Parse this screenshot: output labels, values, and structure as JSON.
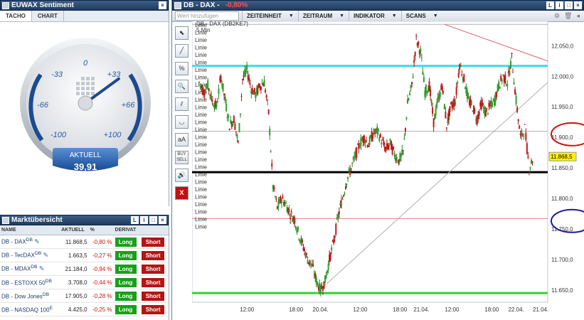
{
  "sentiment": {
    "title": "EUWAX Sentiment",
    "tabs": [
      "TACHO",
      "CHART"
    ],
    "scale_labels": [
      "0",
      "-33",
      "+33",
      "-66",
      "+66",
      "-100",
      "+100"
    ],
    "aktuell_label": "AKTUELL",
    "aktuell_value": "39,91",
    "gauge_value": 39.91
  },
  "market": {
    "title": "Marktübersicht",
    "columns": [
      "NAME",
      "AKTUELL",
      "%",
      "DERIVAT"
    ],
    "rows": [
      {
        "name": "DB - DAX",
        "sup": "DB",
        "edit": true,
        "value": "11.868,5",
        "pct": "-0,80 %"
      },
      {
        "name": "DB - TecDAX",
        "sup": "DB",
        "edit": true,
        "value": "1.663,5",
        "pct": "-0,27 %"
      },
      {
        "name": "DB - MDAX",
        "sup": "DB",
        "edit": true,
        "value": "21.184,0",
        "pct": "-0,94 %"
      },
      {
        "name": "DB - ESTOXX 50",
        "sup": "DB",
        "edit": false,
        "value": "3.708,0",
        "pct": "-0,44 %"
      },
      {
        "name": "DB - Dow Jones",
        "sup": "DB",
        "edit": false,
        "value": "17.905,0",
        "pct": "-0,28 %"
      },
      {
        "name": "DB - NASDAQ 100",
        "sup": "E",
        "edit": false,
        "value": "4.425,0",
        "pct": "-0,25 %"
      }
    ],
    "long_label": "Long",
    "short_label": "Short"
  },
  "chart_window": {
    "title": "DB - DAX -",
    "title_change": "-0,80%",
    "search_placeholder": "Wert hinzufügen",
    "menus": [
      "ZEITEINHEIT",
      "ZEITRAUM",
      "INDIKATOR",
      "SCANS"
    ],
    "tools": [
      "cursor-tool",
      "line-tool",
      "percent-tool",
      "zoom-tool",
      "parallel-tool",
      "curve-tool",
      "text-tool",
      "buy-sell-tool",
      "sound-tool",
      "delete-tool"
    ],
    "buy_label": "BUY",
    "sell_label": "SELL",
    "text_tool_label": "aA",
    "delete_label": "X"
  },
  "chart_data": {
    "type": "candlestick",
    "title": "DB - DAX (DB2KE7)",
    "subtitle": "5 Min",
    "y_ticks": [
      "12.050,0",
      "12.000,0",
      "11.950,0",
      "11.900,0",
      "11.850,0",
      "11.800,0",
      "11.750,0",
      "11.700,0",
      "11.650,0"
    ],
    "x_ticks": [
      "12:00",
      "18:00",
      "20.04.",
      "12:00",
      "18:00",
      "21.04.",
      "12:00",
      "18:00",
      "22.04.",
      "21.04."
    ],
    "ylim": [
      11630,
      12090
    ],
    "last_price": "11.868,5",
    "last_price_value": 11868.5,
    "line_label": "Linie",
    "horizontal_lines": [
      {
        "value": 12085,
        "color": "#b0b0b0"
      },
      {
        "value": 12017,
        "color": "#3ddcf0"
      },
      {
        "value": 11910,
        "color": "#b0b0b0"
      },
      {
        "value": 11843,
        "color": "#000000"
      },
      {
        "value": 11767,
        "color": "#e08080"
      },
      {
        "value": 11645,
        "color": "#2ed32e"
      }
    ],
    "marked_levels": [
      {
        "value": 11905,
        "color": "#d01010"
      },
      {
        "value": 11763,
        "color": "#1a1a9a"
      }
    ],
    "price_path": [
      [
        0,
        11990
      ],
      [
        2,
        11975
      ],
      [
        4,
        11985
      ],
      [
        6,
        11960
      ],
      [
        8,
        11950
      ],
      [
        10,
        12000
      ],
      [
        12,
        11960
      ],
      [
        14,
        11920
      ],
      [
        16,
        11930
      ],
      [
        18,
        11890
      ],
      [
        20,
        11995
      ],
      [
        22,
        12010
      ],
      [
        24,
        11980
      ],
      [
        26,
        11970
      ],
      [
        28,
        11985
      ],
      [
        30,
        11990
      ],
      [
        32,
        11940
      ],
      [
        34,
        11820
      ],
      [
        36,
        11785
      ],
      [
        38,
        11800
      ],
      [
        40,
        11790
      ],
      [
        42,
        11775
      ],
      [
        44,
        11765
      ],
      [
        46,
        11740
      ],
      [
        48,
        11720
      ],
      [
        50,
        11700
      ],
      [
        52,
        11690
      ],
      [
        54,
        11665
      ],
      [
        56,
        11650
      ],
      [
        58,
        11665
      ],
      [
        60,
        11700
      ],
      [
        62,
        11730
      ],
      [
        64,
        11770
      ],
      [
        66,
        11800
      ],
      [
        68,
        11830
      ],
      [
        70,
        11850
      ],
      [
        72,
        11870
      ],
      [
        74,
        11890
      ],
      [
        76,
        11900
      ],
      [
        78,
        11888
      ],
      [
        80,
        11905
      ],
      [
        82,
        11910
      ],
      [
        84,
        11895
      ],
      [
        86,
        11880
      ],
      [
        88,
        11890
      ],
      [
        90,
        11872
      ],
      [
        92,
        11862
      ],
      [
        94,
        11875
      ],
      [
        96,
        11955
      ],
      [
        98,
        11985
      ],
      [
        100,
        12060
      ],
      [
        102,
        12040
      ],
      [
        104,
        11975
      ],
      [
        106,
        11985
      ],
      [
        108,
        11925
      ],
      [
        110,
        11960
      ],
      [
        112,
        11985
      ],
      [
        114,
        11920
      ],
      [
        116,
        11950
      ],
      [
        118,
        11960
      ],
      [
        120,
        12020
      ],
      [
        122,
        11995
      ],
      [
        124,
        11960
      ],
      [
        126,
        11950
      ],
      [
        128,
        11930
      ],
      [
        130,
        11955
      ],
      [
        132,
        11940
      ],
      [
        134,
        11950
      ],
      [
        136,
        11960
      ],
      [
        138,
        11985
      ],
      [
        140,
        12000
      ],
      [
        142,
        11990
      ],
      [
        144,
        12030
      ],
      [
        146,
        11960
      ],
      [
        148,
        11900
      ],
      [
        150,
        11915
      ],
      [
        152,
        11850
      ],
      [
        154,
        11868
      ]
    ]
  }
}
